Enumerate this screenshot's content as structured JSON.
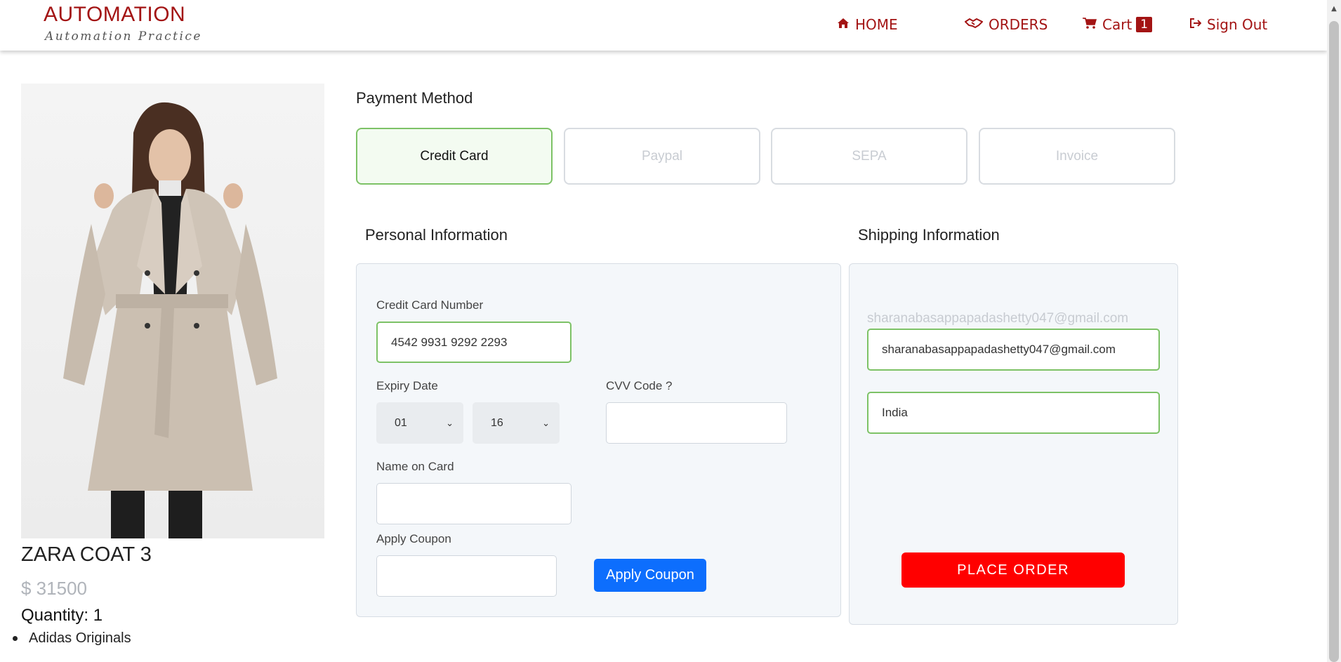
{
  "header": {
    "brand": "AUTOMATION",
    "tagline": "Automation Practice",
    "nav": {
      "home_icon": "home-icon",
      "home": "HOME",
      "orders_icon": "handshake-icon",
      "orders": "ORDERS",
      "cart_icon": "cart-icon",
      "cart": "Cart",
      "cart_count": "1",
      "signout_icon": "sign-out-icon",
      "signout": "Sign Out"
    }
  },
  "product": {
    "name": "ZARA COAT 3",
    "price": "$ 31500",
    "quantity": "Quantity: 1",
    "features": [
      "Adidas Originals"
    ]
  },
  "payment": {
    "title": "Payment Method",
    "methods": [
      {
        "label": "Credit Card",
        "active": true
      },
      {
        "label": "Paypal",
        "active": false
      },
      {
        "label": "SEPA",
        "active": false
      },
      {
        "label": "Invoice",
        "active": false
      }
    ]
  },
  "personal": {
    "title": "Personal Information",
    "card_number_label": "Credit Card Number",
    "card_number_value": "4542 9931 9292 2293",
    "expiry_label": "Expiry Date",
    "expiry_month": "01",
    "expiry_year": "16",
    "cvv_label": "CVV Code ?",
    "cvv_value": "",
    "name_label": "Name on Card",
    "name_value": "",
    "coupon_label": "Apply Coupon",
    "coupon_value": "",
    "coupon_button": "Apply Coupon"
  },
  "shipping": {
    "title": "Shipping Information",
    "email_label": "sharanabasappapadashetty047@gmail.com",
    "email_value": "sharanabasappapadashetty047@gmail.com",
    "country_value": "India",
    "place_order": "PLACE ORDER"
  },
  "colors": {
    "brand": "#a31414",
    "active_border": "#7dc266",
    "primary_button": "#0d6efd",
    "place_order": "#ff0000"
  }
}
